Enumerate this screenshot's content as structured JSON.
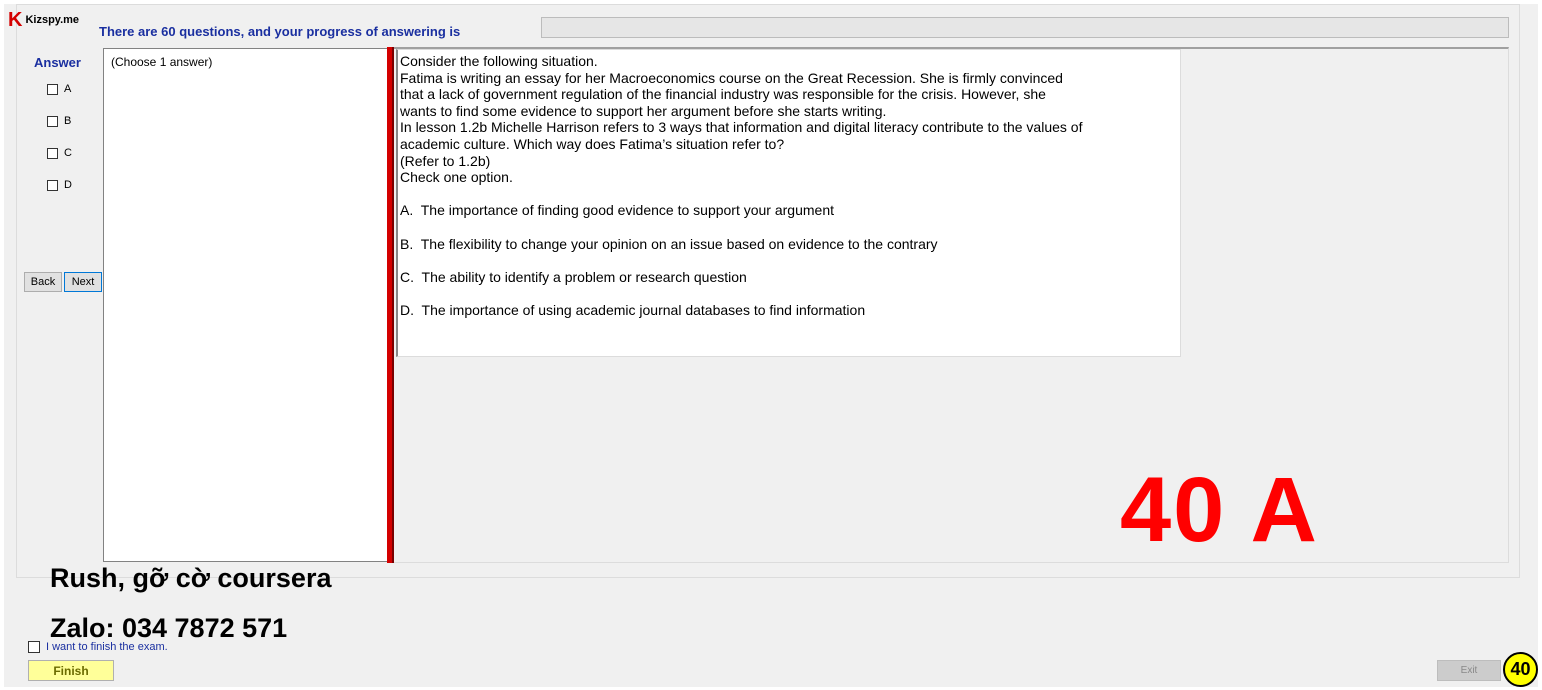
{
  "logo": {
    "mark": "K",
    "text": "Kizspy.me"
  },
  "header": {
    "progress_text": "There are 60 questions, and your progress of answering is",
    "progress_percent": 0
  },
  "answer_panel": {
    "heading": "Answer",
    "options": [
      "A",
      "B",
      "C",
      "D"
    ],
    "back_label": "Back",
    "next_label": "Next",
    "choose_hint": "(Choose 1 answer)"
  },
  "question": {
    "lines": [
      "Consider the following situation.",
      "Fatima is writing an essay for her Macroeconomics course on the Great Recession. She is firmly convinced",
      "that a lack of government regulation of the financial industry was responsible for the crisis. However, she",
      "wants to find some evidence to support her argument before she starts writing.",
      "In lesson 1.2b Michelle Harrison refers to 3 ways that information and digital literacy contribute to the values of",
      "academic culture. Which way does Fatima’s situation refer to?",
      "(Refer to 1.2b)",
      "Check one option."
    ],
    "choices": [
      "A.  The importance of finding good evidence to support your argument",
      "B.  The flexibility to change your opinion on an issue based on evidence to the contrary",
      "C.  The ability to identify a problem or research question",
      "D.  The importance of using academic journal databases to find information"
    ]
  },
  "overlay": {
    "answer": "40 A",
    "watermark_line1": "Rush, gỡ cờ coursera",
    "watermark_line2": "Zalo: 034 7872 571"
  },
  "footer": {
    "finish_check_label": "I want to finish the exam.",
    "finish_label": "Finish",
    "exit_label": "Exit",
    "badge": "40"
  },
  "colors": {
    "accent_red": "#ff0000",
    "heading_blue": "#1a2fa0",
    "finish_yellow": "#ffff99"
  }
}
